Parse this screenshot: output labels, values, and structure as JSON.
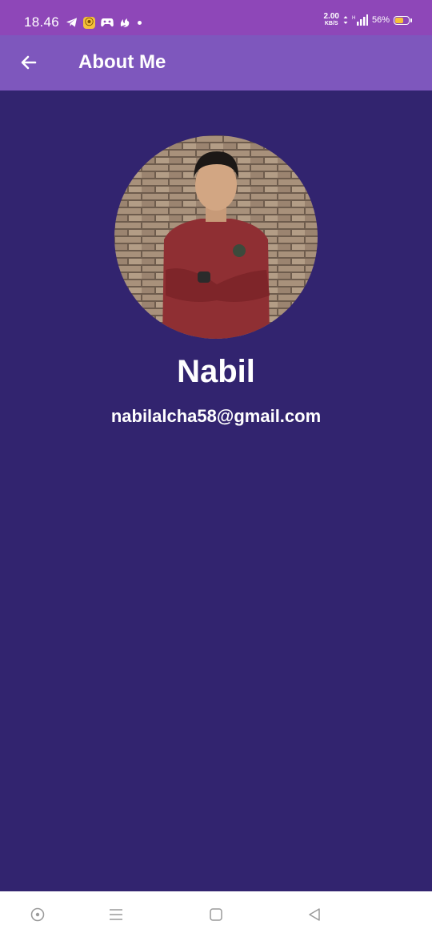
{
  "status_bar": {
    "time": "18.46",
    "net_speed_value": "2.00",
    "net_speed_unit": "KB/S",
    "battery_percent": "56%",
    "icons": [
      "telegram-icon",
      "coin-app-icon",
      "gamepad-icon",
      "uc-browser-icon",
      "notification-dot-icon",
      "data-arrows-icon",
      "signal-icon",
      "battery-icon"
    ]
  },
  "app_bar": {
    "title": "About Me",
    "back_icon": "arrow-left-icon"
  },
  "profile": {
    "name": "Nabil",
    "email": "nabilalcha58@gmail.com",
    "avatar": "profile-photo"
  },
  "nav_bar": {
    "icons": [
      "assistant-icon",
      "menu-icon",
      "home-square-icon",
      "back-triangle-icon"
    ]
  },
  "colors": {
    "status_bar": "#8e47b8",
    "app_bar": "#7e57bd",
    "background": "#32246f",
    "text": "#ffffff",
    "battery_fill": "#f5c23a"
  }
}
